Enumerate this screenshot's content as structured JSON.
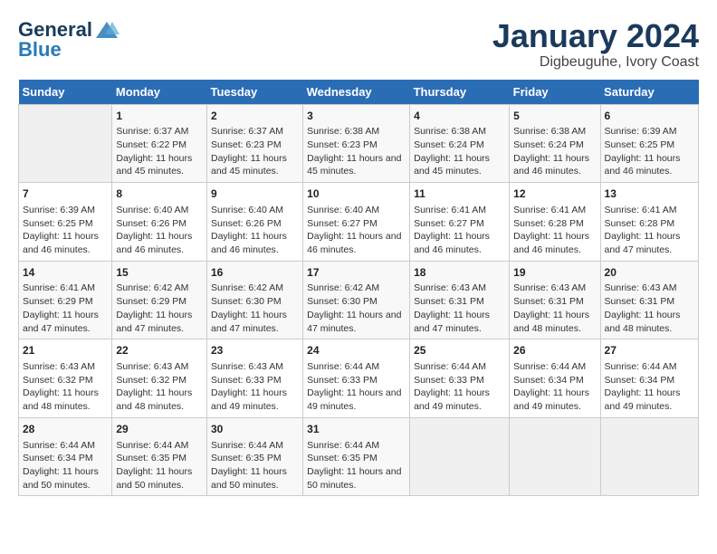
{
  "logo": {
    "line1": "General",
    "line2": "Blue"
  },
  "title": "January 2024",
  "subtitle": "Digbeuguhe, Ivory Coast",
  "weekdays": [
    "Sunday",
    "Monday",
    "Tuesday",
    "Wednesday",
    "Thursday",
    "Friday",
    "Saturday"
  ],
  "weeks": [
    [
      {
        "day": "",
        "sunrise": "",
        "sunset": "",
        "daylight": ""
      },
      {
        "day": "1",
        "sunrise": "Sunrise: 6:37 AM",
        "sunset": "Sunset: 6:22 PM",
        "daylight": "Daylight: 11 hours and 45 minutes."
      },
      {
        "day": "2",
        "sunrise": "Sunrise: 6:37 AM",
        "sunset": "Sunset: 6:23 PM",
        "daylight": "Daylight: 11 hours and 45 minutes."
      },
      {
        "day": "3",
        "sunrise": "Sunrise: 6:38 AM",
        "sunset": "Sunset: 6:23 PM",
        "daylight": "Daylight: 11 hours and 45 minutes."
      },
      {
        "day": "4",
        "sunrise": "Sunrise: 6:38 AM",
        "sunset": "Sunset: 6:24 PM",
        "daylight": "Daylight: 11 hours and 45 minutes."
      },
      {
        "day": "5",
        "sunrise": "Sunrise: 6:38 AM",
        "sunset": "Sunset: 6:24 PM",
        "daylight": "Daylight: 11 hours and 46 minutes."
      },
      {
        "day": "6",
        "sunrise": "Sunrise: 6:39 AM",
        "sunset": "Sunset: 6:25 PM",
        "daylight": "Daylight: 11 hours and 46 minutes."
      }
    ],
    [
      {
        "day": "7",
        "sunrise": "Sunrise: 6:39 AM",
        "sunset": "Sunset: 6:25 PM",
        "daylight": "Daylight: 11 hours and 46 minutes."
      },
      {
        "day": "8",
        "sunrise": "Sunrise: 6:40 AM",
        "sunset": "Sunset: 6:26 PM",
        "daylight": "Daylight: 11 hours and 46 minutes."
      },
      {
        "day": "9",
        "sunrise": "Sunrise: 6:40 AM",
        "sunset": "Sunset: 6:26 PM",
        "daylight": "Daylight: 11 hours and 46 minutes."
      },
      {
        "day": "10",
        "sunrise": "Sunrise: 6:40 AM",
        "sunset": "Sunset: 6:27 PM",
        "daylight": "Daylight: 11 hours and 46 minutes."
      },
      {
        "day": "11",
        "sunrise": "Sunrise: 6:41 AM",
        "sunset": "Sunset: 6:27 PM",
        "daylight": "Daylight: 11 hours and 46 minutes."
      },
      {
        "day": "12",
        "sunrise": "Sunrise: 6:41 AM",
        "sunset": "Sunset: 6:28 PM",
        "daylight": "Daylight: 11 hours and 46 minutes."
      },
      {
        "day": "13",
        "sunrise": "Sunrise: 6:41 AM",
        "sunset": "Sunset: 6:28 PM",
        "daylight": "Daylight: 11 hours and 47 minutes."
      }
    ],
    [
      {
        "day": "14",
        "sunrise": "Sunrise: 6:41 AM",
        "sunset": "Sunset: 6:29 PM",
        "daylight": "Daylight: 11 hours and 47 minutes."
      },
      {
        "day": "15",
        "sunrise": "Sunrise: 6:42 AM",
        "sunset": "Sunset: 6:29 PM",
        "daylight": "Daylight: 11 hours and 47 minutes."
      },
      {
        "day": "16",
        "sunrise": "Sunrise: 6:42 AM",
        "sunset": "Sunset: 6:30 PM",
        "daylight": "Daylight: 11 hours and 47 minutes."
      },
      {
        "day": "17",
        "sunrise": "Sunrise: 6:42 AM",
        "sunset": "Sunset: 6:30 PM",
        "daylight": "Daylight: 11 hours and 47 minutes."
      },
      {
        "day": "18",
        "sunrise": "Sunrise: 6:43 AM",
        "sunset": "Sunset: 6:31 PM",
        "daylight": "Daylight: 11 hours and 47 minutes."
      },
      {
        "day": "19",
        "sunrise": "Sunrise: 6:43 AM",
        "sunset": "Sunset: 6:31 PM",
        "daylight": "Daylight: 11 hours and 48 minutes."
      },
      {
        "day": "20",
        "sunrise": "Sunrise: 6:43 AM",
        "sunset": "Sunset: 6:31 PM",
        "daylight": "Daylight: 11 hours and 48 minutes."
      }
    ],
    [
      {
        "day": "21",
        "sunrise": "Sunrise: 6:43 AM",
        "sunset": "Sunset: 6:32 PM",
        "daylight": "Daylight: 11 hours and 48 minutes."
      },
      {
        "day": "22",
        "sunrise": "Sunrise: 6:43 AM",
        "sunset": "Sunset: 6:32 PM",
        "daylight": "Daylight: 11 hours and 48 minutes."
      },
      {
        "day": "23",
        "sunrise": "Sunrise: 6:43 AM",
        "sunset": "Sunset: 6:33 PM",
        "daylight": "Daylight: 11 hours and 49 minutes."
      },
      {
        "day": "24",
        "sunrise": "Sunrise: 6:44 AM",
        "sunset": "Sunset: 6:33 PM",
        "daylight": "Daylight: 11 hours and 49 minutes."
      },
      {
        "day": "25",
        "sunrise": "Sunrise: 6:44 AM",
        "sunset": "Sunset: 6:33 PM",
        "daylight": "Daylight: 11 hours and 49 minutes."
      },
      {
        "day": "26",
        "sunrise": "Sunrise: 6:44 AM",
        "sunset": "Sunset: 6:34 PM",
        "daylight": "Daylight: 11 hours and 49 minutes."
      },
      {
        "day": "27",
        "sunrise": "Sunrise: 6:44 AM",
        "sunset": "Sunset: 6:34 PM",
        "daylight": "Daylight: 11 hours and 49 minutes."
      }
    ],
    [
      {
        "day": "28",
        "sunrise": "Sunrise: 6:44 AM",
        "sunset": "Sunset: 6:34 PM",
        "daylight": "Daylight: 11 hours and 50 minutes."
      },
      {
        "day": "29",
        "sunrise": "Sunrise: 6:44 AM",
        "sunset": "Sunset: 6:35 PM",
        "daylight": "Daylight: 11 hours and 50 minutes."
      },
      {
        "day": "30",
        "sunrise": "Sunrise: 6:44 AM",
        "sunset": "Sunset: 6:35 PM",
        "daylight": "Daylight: 11 hours and 50 minutes."
      },
      {
        "day": "31",
        "sunrise": "Sunrise: 6:44 AM",
        "sunset": "Sunset: 6:35 PM",
        "daylight": "Daylight: 11 hours and 50 minutes."
      },
      {
        "day": "",
        "sunrise": "",
        "sunset": "",
        "daylight": ""
      },
      {
        "day": "",
        "sunrise": "",
        "sunset": "",
        "daylight": ""
      },
      {
        "day": "",
        "sunrise": "",
        "sunset": "",
        "daylight": ""
      }
    ]
  ]
}
